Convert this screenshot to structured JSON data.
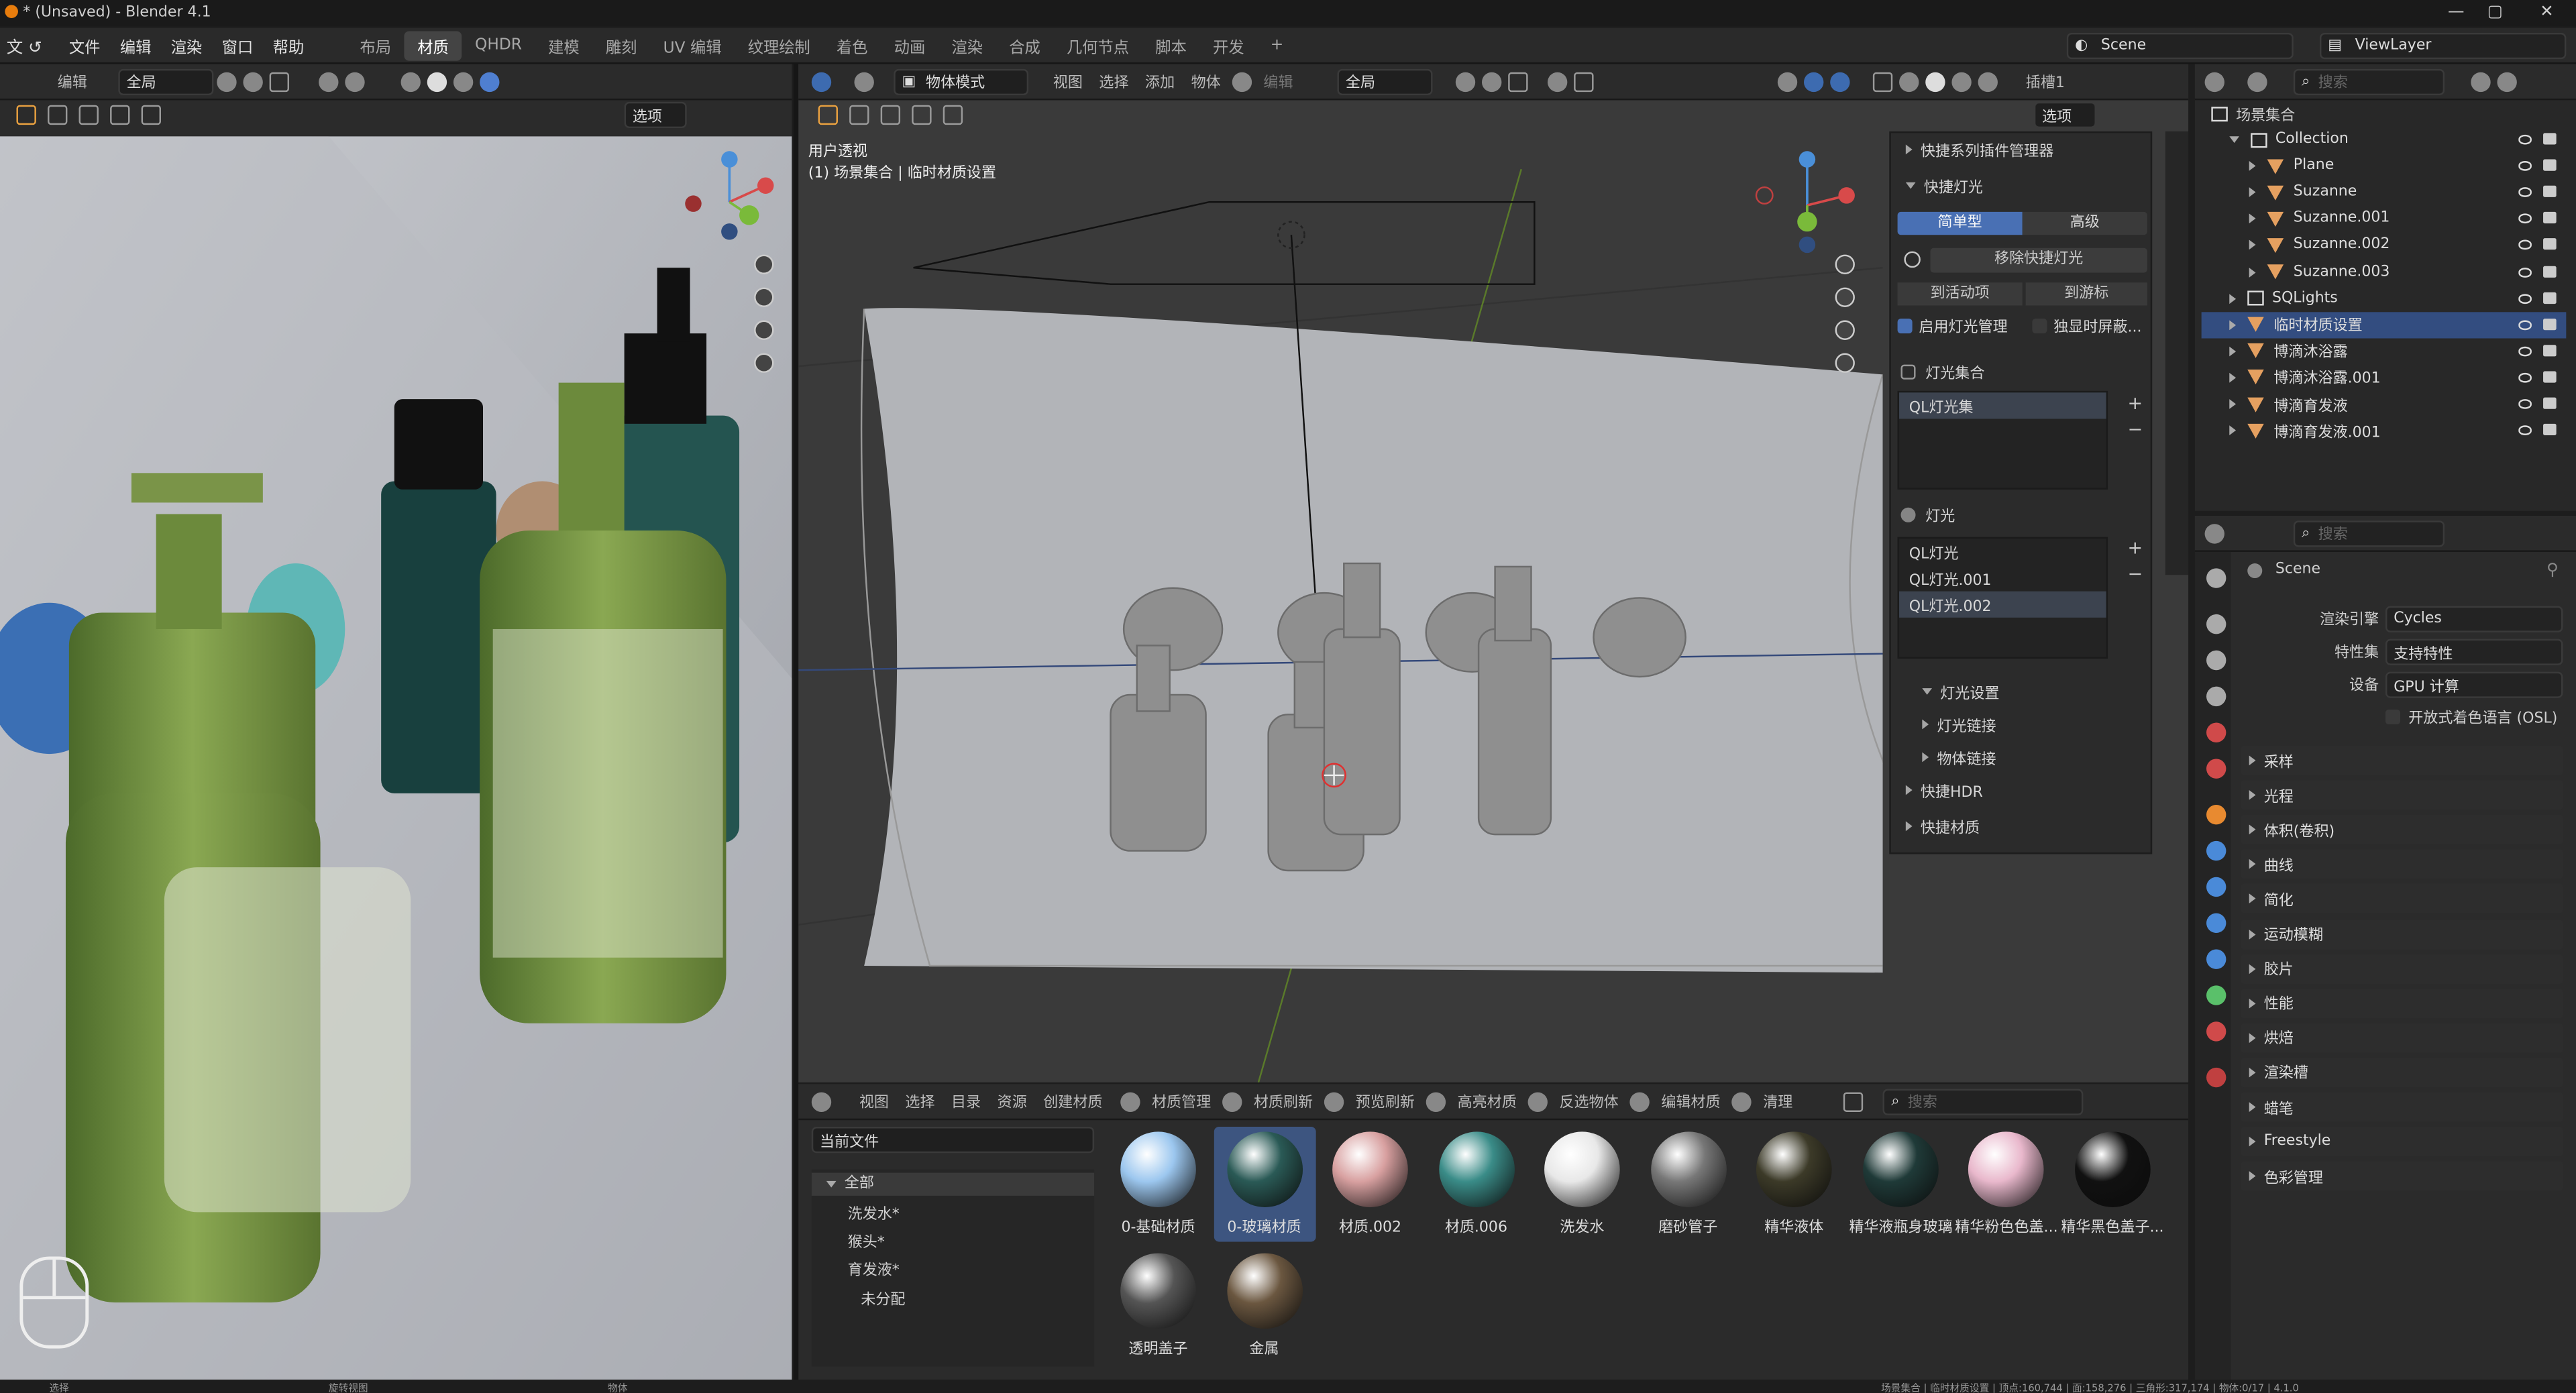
{
  "window": {
    "title": "* (Unsaved) - Blender 4.1"
  },
  "menu": {
    "items": [
      "文件",
      "编辑",
      "渲染",
      "窗口",
      "帮助"
    ],
    "workspaces": [
      "布局",
      "材质",
      "QHDR",
      "建模",
      "雕刻",
      "UV 编辑",
      "纹理绘制",
      "着色",
      "动画",
      "渲染",
      "合成",
      "几何节点",
      "脚本",
      "开发"
    ],
    "active_workspace": "材质",
    "scene": "Scene",
    "view_layer": "ViewLayer"
  },
  "left_view": {
    "edit": "编辑",
    "global": "全局",
    "options": "选项"
  },
  "viewport": {
    "mode": "物体模式",
    "menu": [
      "视图",
      "选择",
      "添加",
      "物体"
    ],
    "edit": "编辑",
    "global": "全局",
    "options": "选项",
    "overlay_line1": "用户透视",
    "overlay_line2": "(1) 场景集合 | 临时材质设置",
    "pipette": "插槽1"
  },
  "npanel": {
    "addon_manager": "快捷系列插件管理器",
    "quick_light": "快捷灯光",
    "tab_simple": "简单型",
    "tab_adv": "高级",
    "remove_btn": "移除快捷灯光",
    "to_active": "到活动项",
    "to_cursor": "到游标",
    "enable_mgr": "启用灯光管理",
    "solo_hide": "独显时屏蔽...",
    "light_collection": "灯光集合",
    "collections": [
      "QL灯光集"
    ],
    "lights_label": "灯光",
    "lights": [
      "QL灯光",
      "QL灯光.001",
      "QL灯光.002"
    ],
    "light_settings": "灯光设置",
    "light_link": "灯光链接",
    "object_link": "物体链接",
    "quick_hdr": "快捷HDR",
    "quick_mat": "快捷材质"
  },
  "outliner": {
    "search": "搜索",
    "root": "场景集合",
    "rows": [
      {
        "name": "Collection",
        "type": "collection",
        "indent": 1
      },
      {
        "name": "Plane",
        "type": "object",
        "indent": 2
      },
      {
        "name": "Suzanne",
        "type": "object",
        "indent": 2
      },
      {
        "name": "Suzanne.001",
        "type": "object",
        "indent": 2
      },
      {
        "name": "Suzanne.002",
        "type": "object",
        "indent": 2
      },
      {
        "name": "Suzanne.003",
        "type": "object",
        "indent": 2
      },
      {
        "name": "SQLights",
        "type": "collection",
        "indent": 1
      },
      {
        "name": "临时材质设置",
        "type": "object",
        "indent": 1,
        "selected": true
      },
      {
        "name": "博滴沐浴露",
        "type": "object",
        "indent": 1
      },
      {
        "name": "博滴沐浴露.001",
        "type": "object",
        "indent": 1
      },
      {
        "name": "博滴育发液",
        "type": "object",
        "indent": 1
      },
      {
        "name": "博滴育发液.001",
        "type": "object",
        "indent": 1
      }
    ]
  },
  "properties": {
    "search": "搜索",
    "scene": "Scene",
    "engine_label": "渲染引擎",
    "engine": "Cycles",
    "featureset_label": "特性集",
    "featureset": "支持特性",
    "device_label": "设备",
    "device": "GPU 计算",
    "osl": "开放式着色语言 (OSL)",
    "sections": [
      "采样",
      "光程",
      "体积(卷积)",
      "曲线",
      "简化",
      "运动模糊",
      "胶片",
      "性能",
      "烘焙",
      "渲染槽",
      "蜡笔",
      "Freestyle",
      "色彩管理"
    ]
  },
  "asset_browser": {
    "menu": [
      "视图",
      "选择",
      "目录",
      "资源",
      "创建材质"
    ],
    "tools": [
      "材质管理",
      "材质刷新",
      "预览刷新",
      "高亮材质",
      "反选物体",
      "编辑材质",
      "清理"
    ],
    "search": "搜索",
    "library": "当前文件",
    "tree_root": "全部",
    "tree_items": [
      "洗发水*",
      "猴头*",
      "育发液*",
      "未分配"
    ],
    "materials": [
      {
        "name": "0-基础材质",
        "color": "#9cc7ef"
      },
      {
        "name": "0-玻璃材质",
        "color": "#2a5a56",
        "selected": true
      },
      {
        "name": "材质.002",
        "color": "#d8a0a0"
      },
      {
        "name": "材质.006",
        "color": "#3a8c88"
      },
      {
        "name": "洗发水",
        "color": "#e8e8e8"
      },
      {
        "name": "磨砂管子",
        "color": "#777777"
      },
      {
        "name": "精华液体",
        "color": "#3c3a28"
      },
      {
        "name": "精华液瓶身玻璃",
        "color": "#1f3a38"
      },
      {
        "name": "精华粉色色盖...",
        "color": "#e9b8cc"
      },
      {
        "name": "精华黑色盖子...",
        "color": "#111111"
      },
      {
        "name": "透明盖子",
        "color": "#555555"
      },
      {
        "name": "金属",
        "color": "#6b5740"
      }
    ]
  },
  "statusbar": {
    "select": "选择",
    "rotate": "旋转视图",
    "object": "物体",
    "info": "场景集合 | 临时材质设置 | 顶点:160,744 | 面:158,276 | 三角形:317,174 | 物体:0/17 | 4.1.0"
  }
}
